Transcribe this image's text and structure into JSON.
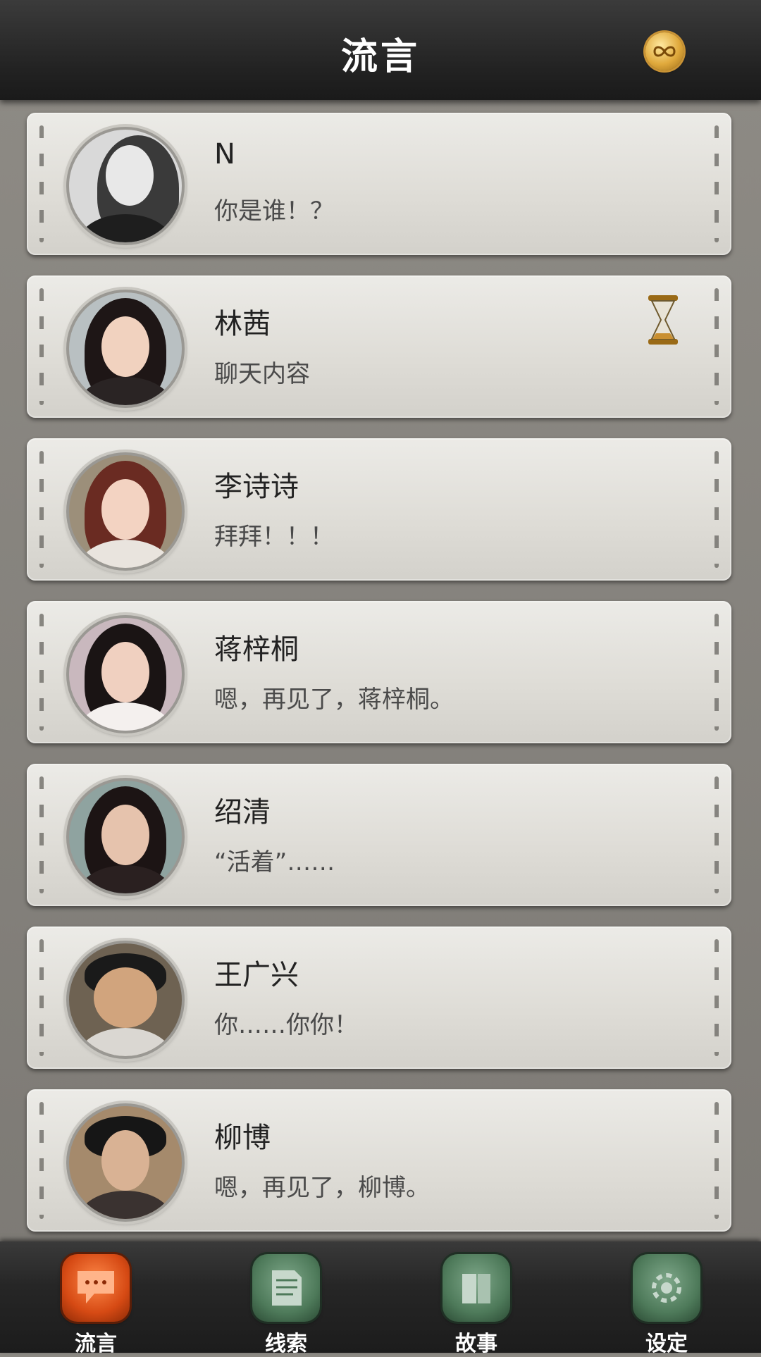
{
  "header": {
    "title": "流言",
    "badge_icon": "infinity-coin-icon"
  },
  "conversations": [
    {
      "name": "N",
      "message": "你是谁！？",
      "avatar_icon": "avatar-n",
      "status_icon": ""
    },
    {
      "name": "林茜",
      "message": "聊天内容",
      "avatar_icon": "avatar-linqian",
      "status_icon": "hourglass-icon"
    },
    {
      "name": "李诗诗",
      "message": "拜拜！！！",
      "avatar_icon": "avatar-lishishi",
      "status_icon": ""
    },
    {
      "name": "蒋梓桐",
      "message": "嗯，再见了，蒋梓桐。",
      "avatar_icon": "avatar-jiangzitong",
      "status_icon": ""
    },
    {
      "name": "绍清",
      "message": "“活着”……",
      "avatar_icon": "avatar-shaoqing",
      "status_icon": ""
    },
    {
      "name": "王广兴",
      "message": "你……你你！",
      "avatar_icon": "avatar-wangguangxing",
      "status_icon": ""
    },
    {
      "name": "柳博",
      "message": "嗯，再见了，柳博。",
      "avatar_icon": "avatar-liubo",
      "status_icon": ""
    }
  ],
  "tabs": [
    {
      "label": "流言",
      "icon": "chat-bubble-icon",
      "active": true
    },
    {
      "label": "线索",
      "icon": "document-icon",
      "active": false
    },
    {
      "label": "故事",
      "icon": "book-icon",
      "active": false
    },
    {
      "label": "设定",
      "icon": "gear-icon",
      "active": false
    }
  ],
  "colors": {
    "accent_active": "#d64a14",
    "tab_idle": "#4e7a5a",
    "header_bg": "#262626"
  }
}
